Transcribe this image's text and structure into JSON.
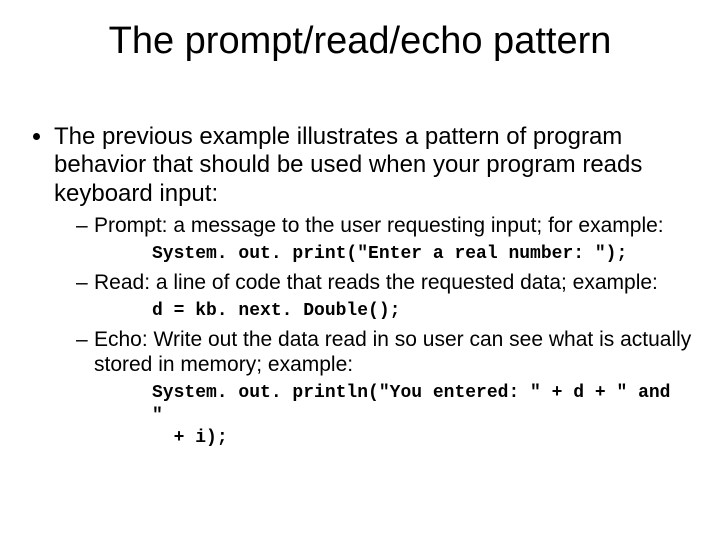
{
  "title": "The prompt/read/echo pattern",
  "bullet": "The previous example illustrates a pattern of program behavior that should be used when your program reads keyboard input:",
  "items": [
    {
      "text": "Prompt: a message to the user requesting input; for example:",
      "code": "System. out. print(\"Enter a real number: \");"
    },
    {
      "text": "Read: a line of code that reads the requested data; example:",
      "code": "d = kb. next. Double();"
    },
    {
      "text": "Echo: Write out the data read in so user can see what is actually stored in memory; example:",
      "code": "System. out. println(\"You entered: \" + d + \" and \"\n  + i);"
    }
  ]
}
